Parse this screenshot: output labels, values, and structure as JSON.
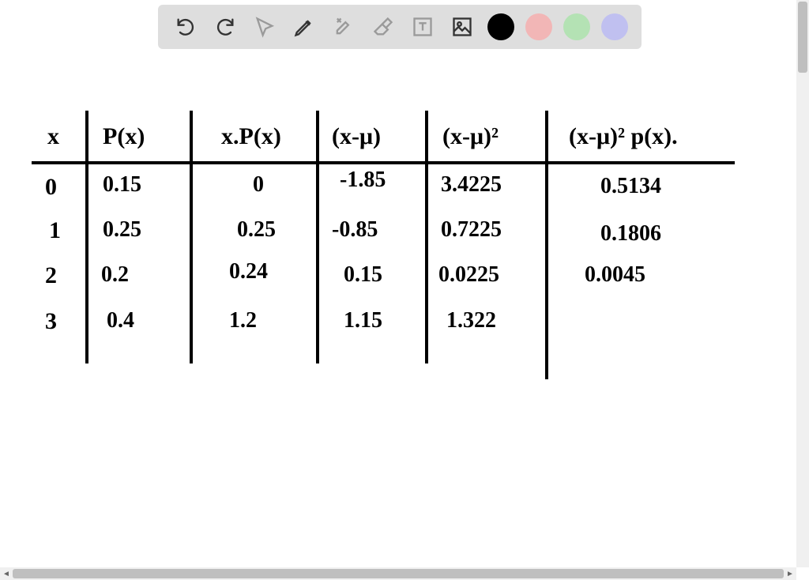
{
  "toolbar": {
    "icons": {
      "undo": "undo-icon",
      "redo": "redo-icon",
      "pointer": "pointer-icon",
      "pen": "pen-icon",
      "tools": "tools-icon",
      "eraser": "eraser-icon",
      "text": "text-icon",
      "image": "image-icon"
    },
    "colors": {
      "black": "#000000",
      "pink": "#f2b6b6",
      "green": "#b4e2b4",
      "purple": "#c0c0f0"
    }
  },
  "table": {
    "headers": {
      "x": "x",
      "px": "P(x)",
      "xpx": "x.P(x)",
      "xmu": "(x-μ)",
      "xmu2": "(x-μ)²",
      "xmu2px": "(x-μ)² p(x)."
    },
    "rows": [
      {
        "x": "0",
        "px": "0.15",
        "xpx": "0",
        "xmu": "-1.85",
        "xmu2": "3.4225",
        "xmu2px": "0.5134"
      },
      {
        "x": "1",
        "px": "0.25",
        "xpx": "0.25",
        "xmu": "-0.85",
        "xmu2": "0.7225",
        "xmu2px": "0.1806"
      },
      {
        "x": "2",
        "px": "0.2",
        "xpx": "0.24",
        "xmu": "0.15",
        "xmu2": "0.0225",
        "xmu2px": "0.0045"
      },
      {
        "x": "3",
        "px": "0.4",
        "xpx": "1.2",
        "xmu": "1.15",
        "xmu2": "1.322",
        "xmu2px": ""
      }
    ]
  },
  "chart_data": {
    "type": "table",
    "title": "Probability distribution variance worksheet",
    "columns": [
      "x",
      "P(x)",
      "x·P(x)",
      "(x-μ)",
      "(x-μ)²",
      "(x-μ)²·P(x)"
    ],
    "rows": [
      [
        0,
        0.15,
        0,
        -1.85,
        3.4225,
        0.5134
      ],
      [
        1,
        0.25,
        0.25,
        -0.85,
        0.7225,
        0.1806
      ],
      [
        2,
        0.2,
        0.24,
        0.15,
        0.0225,
        0.0045
      ],
      [
        3,
        0.4,
        1.2,
        1.15,
        1.322,
        null
      ]
    ]
  }
}
